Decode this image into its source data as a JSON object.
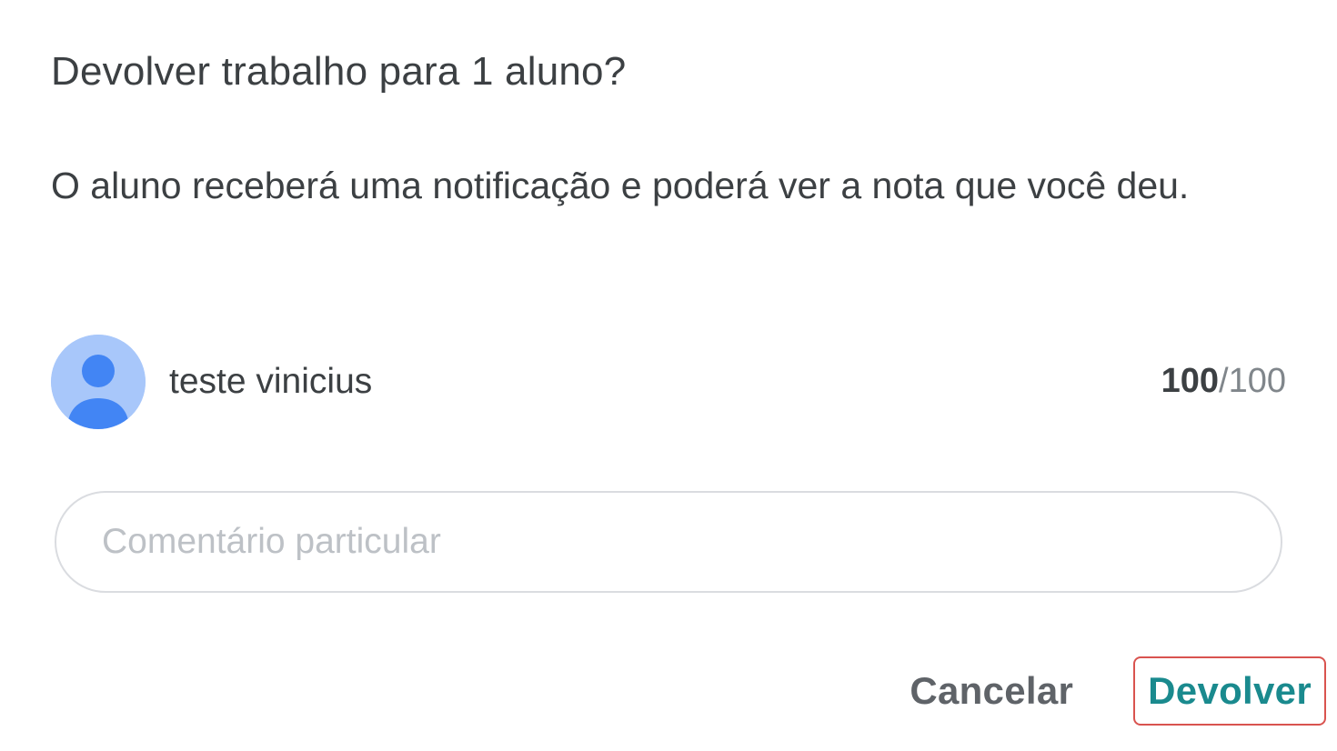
{
  "dialog": {
    "title": "Devolver trabalho para 1 aluno?",
    "message": "O aluno receberá uma notificação e poderá ver a nota que você deu."
  },
  "student": {
    "name": "teste vinicius",
    "avatar_icon": "person-avatar-icon",
    "grade": "100",
    "grade_separator": "/",
    "grade_total": "100"
  },
  "comment": {
    "placeholder": "Comentário particular",
    "value": ""
  },
  "actions": {
    "cancel_label": "Cancelar",
    "return_label": "Devolver"
  },
  "colors": {
    "accent": "#1a8a8e",
    "highlight_border": "#d9534f",
    "avatar_bg": "#a8c7fa",
    "avatar_fg": "#4285f4"
  }
}
